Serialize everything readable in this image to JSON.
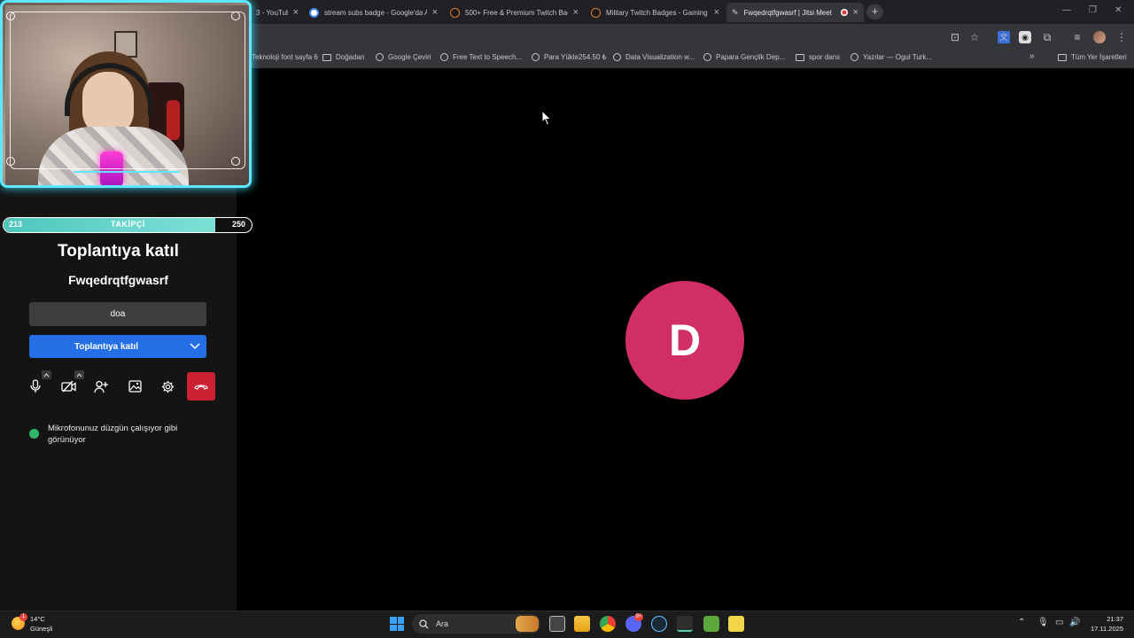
{
  "browser": {
    "tabs": [
      {
        "title": "3 - YouTube",
        "icon": "youtube-icon",
        "active": false
      },
      {
        "title": "stream subs badge - Google'da Ara",
        "icon": "google-icon",
        "active": false
      },
      {
        "title": "500+ Free & Premium Twitch Badges",
        "icon": "twitch-tool-icon",
        "active": false
      },
      {
        "title": "Military Twitch Badges - Gaming",
        "icon": "twitch-tool-icon",
        "active": false
      },
      {
        "title": "Fwqedrqtfgwasrf | Jitsi Meet",
        "icon": "jitsi-icon",
        "active": true,
        "recording": true
      }
    ],
    "new_tab": "+",
    "bookmarks": [
      {
        "label": "Teknoloji font sayfa 6",
        "type": "link"
      },
      {
        "label": "Doğadan",
        "type": "folder"
      },
      {
        "label": "Google Çeviri",
        "type": "link"
      },
      {
        "label": "Free Text to Speech...",
        "type": "link"
      },
      {
        "label": "Para Yükle254.50 ₺",
        "type": "link"
      },
      {
        "label": "Data Visualization w...",
        "type": "link"
      },
      {
        "label": "Papara Gençlik Dep...",
        "type": "link"
      },
      {
        "label": "spor dans",
        "type": "folder"
      },
      {
        "label": "Yazılar — Ogul Turk...",
        "type": "link"
      }
    ],
    "more_bookmarks": "»",
    "all_bookmarks": "Tüm Yer İşaretleri"
  },
  "overlay": {
    "follower_current": "213",
    "follower_goal": "250",
    "follower_label": "TAKİPÇİ",
    "follower_progress": 0.852
  },
  "prejoin": {
    "title": "Toplantıya katıl",
    "room_name": "Fwqedrqtfgwasrf",
    "name_value": "doa",
    "join_label": "Toplantıya katıl",
    "mic_status": "Mikrofonunuz düzgün çalışıyor gibi görünüyor",
    "controls": [
      "microphone-icon",
      "camera-off-icon",
      "invite-icon",
      "background-icon",
      "settings-icon",
      "hangup-icon"
    ],
    "colors": {
      "join": "#246fe5",
      "hangup": "#cb2233",
      "status_ok": "#31b76a"
    }
  },
  "stage": {
    "avatar_initial": "D",
    "avatar_color": "#d12e65"
  },
  "taskbar": {
    "weather_temp": "14°C",
    "weather_desc": "Güneşli",
    "search_placeholder": "Ara",
    "time": "21:37",
    "date": "17.11.2025",
    "discord_badge": "9+"
  }
}
